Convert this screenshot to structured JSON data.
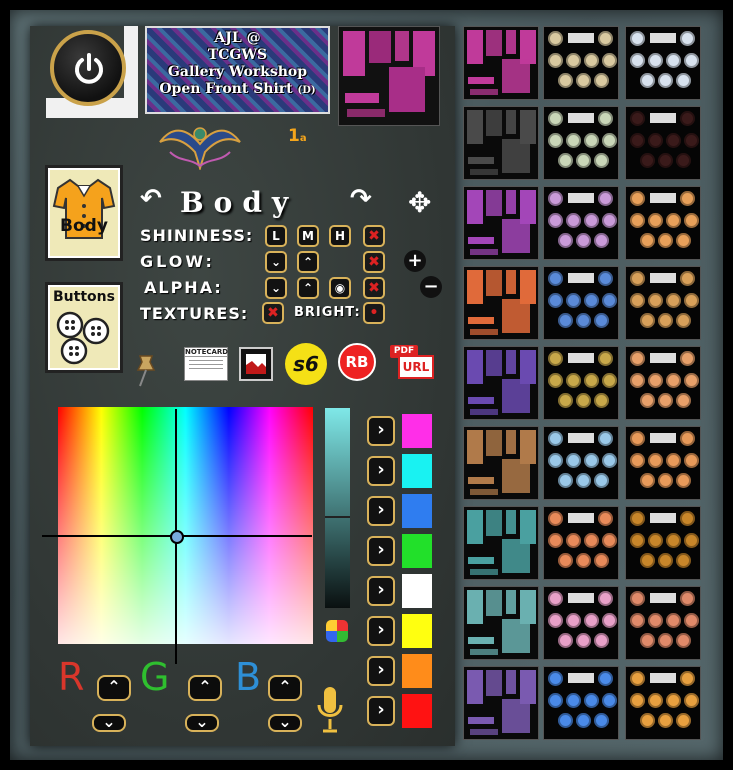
{
  "title_card": {
    "line1": "AJL @",
    "line2": "TCGWS",
    "line3": "Gallery Workshop",
    "line4": "Open Front Shirt",
    "line4_suffix": "(D)"
  },
  "version": {
    "number": "1",
    "suffix": "a"
  },
  "cards": {
    "body_label": "Body",
    "buttons_label": "Buttons"
  },
  "section": {
    "title": "Body"
  },
  "controls": {
    "shininess_label": "SHININESS:",
    "shininess_options": [
      "L",
      "M",
      "H"
    ],
    "glow_label": "GLOW:",
    "alpha_label": "ALPHA:",
    "textures_label": "TEXTURES:",
    "bright_label": "BRIGHT:"
  },
  "toolbar": {
    "notecard_label": "NOTECARD",
    "s6_label": "s6",
    "rb_label": "RB",
    "pdf_label": "PDF",
    "url_label": "URL"
  },
  "rgb": {
    "r_label": "R",
    "g_label": "G",
    "b_label": "B",
    "r_color": "#d9362b",
    "g_color": "#2fbf2f",
    "b_color": "#2e8fd6"
  },
  "swatches": [
    "#ff2ee8",
    "#19f2f2",
    "#2f7df0",
    "#22e02a",
    "#ffffff",
    "#ffff10",
    "#ff8c1a",
    "#ff1212"
  ],
  "thumbnail_grid": {
    "shirt_colors": [
      "#c03a9a",
      "#4a4a4a",
      "#a346b8",
      "#e06a3a",
      "#6a4ab0",
      "#b07a4a",
      "#4aa0a0",
      "#6ab0b0",
      "#7a5ab0"
    ],
    "button_sets_col1": [
      "#d9c9a0",
      "#c9d6b8",
      "#c99ad8",
      "#5a8ad8",
      "#c8a84a",
      "#9ac8e8",
      "#e88a5a",
      "#e8a0c8",
      "#4a8ae8"
    ],
    "button_sets_col2": [
      "#d8e2ee",
      "#3a1a1a",
      "#e8a05a",
      "#d8a05a",
      "#e8a06a",
      "#e89a5a",
      "#c8862a",
      "#e08a6a",
      "#e8a040"
    ]
  },
  "colors": {
    "accent_gold": "#d8b25a",
    "close_red": "#dd2222",
    "panel_bg": "#303634",
    "frame_bg": "#55676b"
  }
}
